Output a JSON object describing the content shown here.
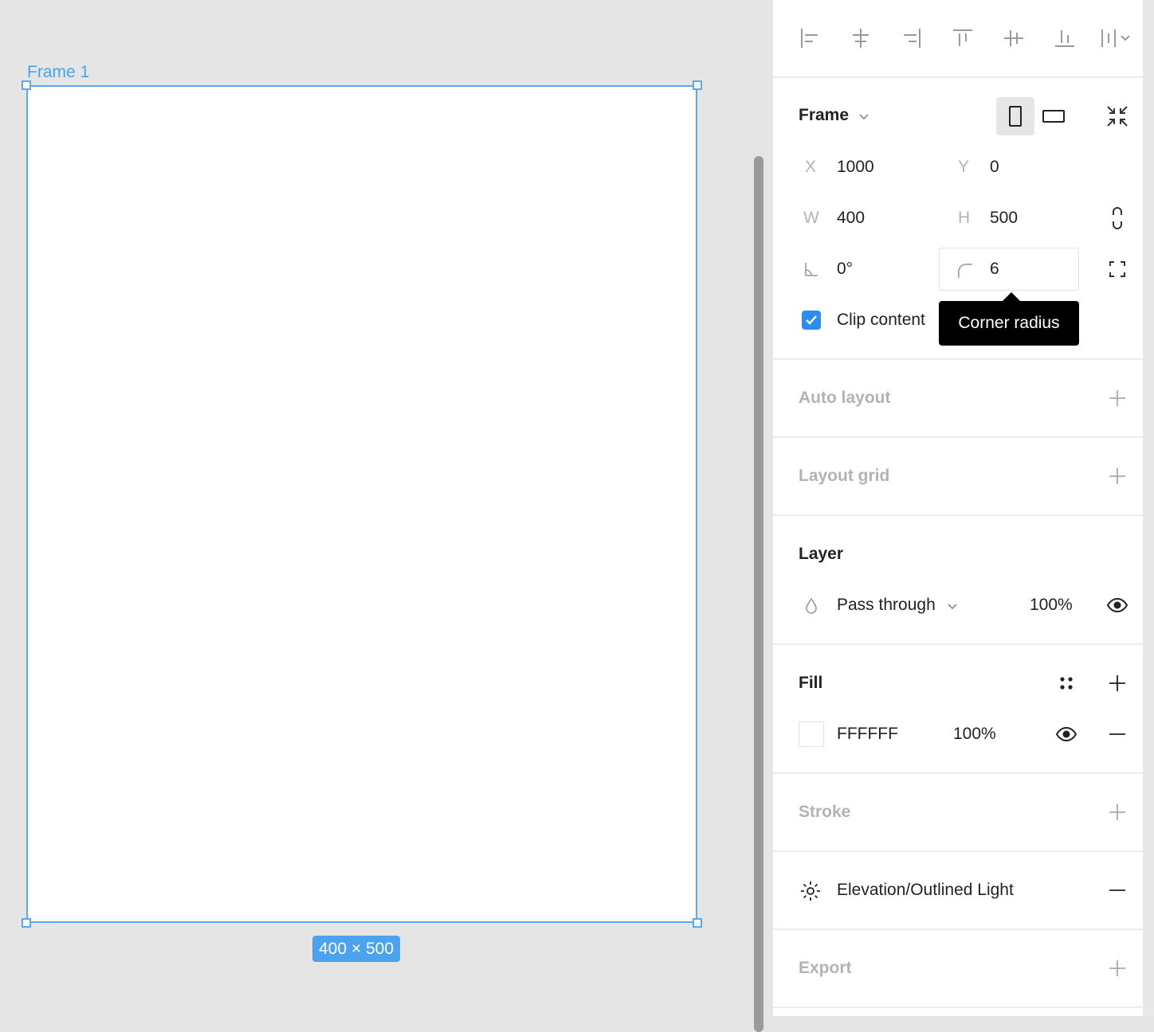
{
  "canvas": {
    "frame_label": "Frame 1",
    "size_badge": "400 × 500",
    "frame_fill": "#FFFFFF",
    "selection_color": "#4BA3F0"
  },
  "toolbar": {
    "align_icons": [
      "align-left-icon",
      "align-horizontal-center-icon",
      "align-right-icon",
      "align-top-icon",
      "align-vertical-center-icon",
      "align-bottom-icon",
      "distribute-icon"
    ]
  },
  "frame_section": {
    "title": "Frame",
    "x_label": "X",
    "x_value": "1000",
    "y_label": "Y",
    "y_value": "0",
    "w_label": "W",
    "w_value": "400",
    "h_label": "H",
    "h_value": "500",
    "rotation_value": "0°",
    "radius_value": "6",
    "tooltip": "Corner radius",
    "clip_label": "Clip content",
    "clip_checked": true
  },
  "sections": {
    "auto_layout": "Auto layout",
    "layout_grid": "Layout grid",
    "layer": "Layer",
    "fill": "Fill",
    "stroke": "Stroke",
    "export": "Export"
  },
  "layer": {
    "blend_mode": "Pass through",
    "opacity": "100%"
  },
  "fill": {
    "hex": "FFFFFF",
    "opacity": "100%"
  },
  "effect": {
    "name": "Elevation/Outlined Light"
  },
  "colors": {
    "accent": "#2D8CF0",
    "tooltip_bg": "#000000",
    "muted_text": "#B3B3B3"
  }
}
